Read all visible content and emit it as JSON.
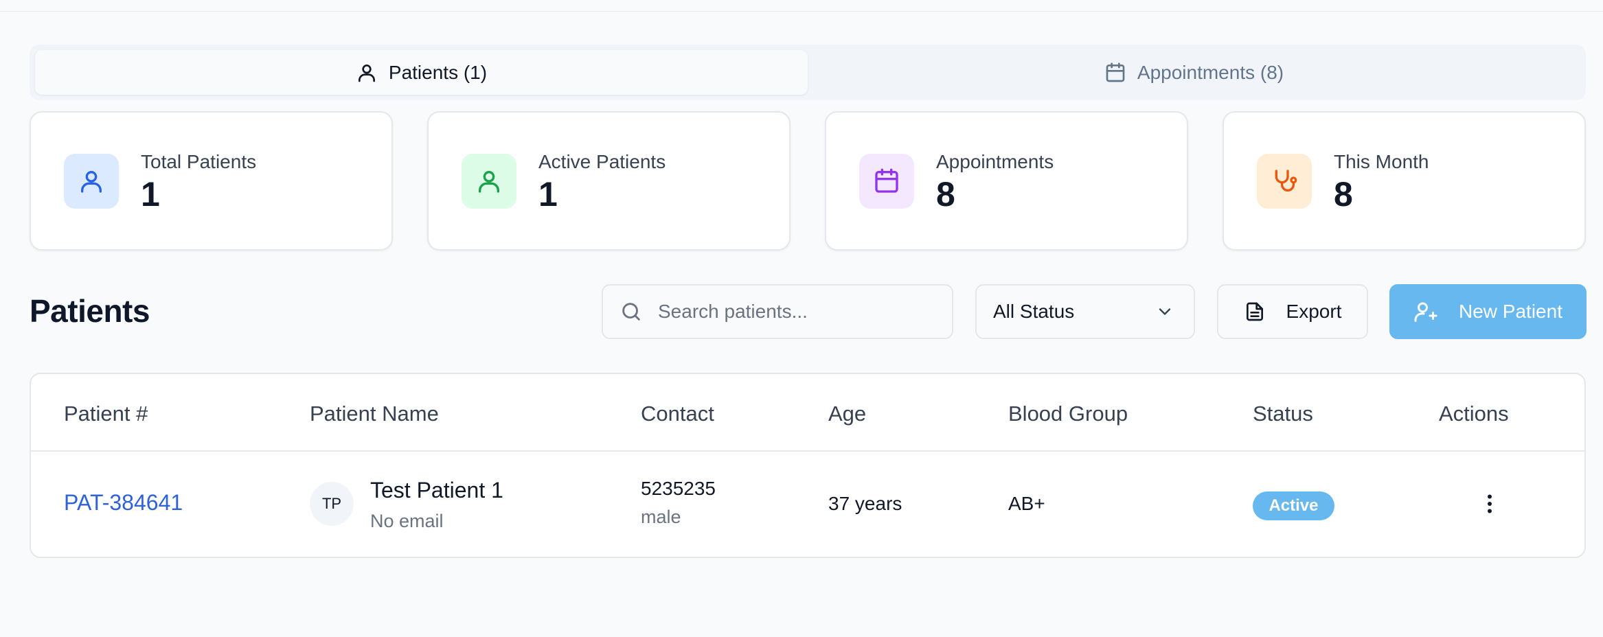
{
  "tabs": [
    {
      "label": "Patients (1)",
      "icon": "user-icon",
      "active": true
    },
    {
      "label": "Appointments (8)",
      "icon": "calendar-icon",
      "active": false
    }
  ],
  "stats": [
    {
      "label": "Total Patients",
      "value": "1",
      "icon": "user-icon",
      "bg": "#dbeafe",
      "color": "#2563eb"
    },
    {
      "label": "Active Patients",
      "value": "1",
      "icon": "user-icon",
      "bg": "#dcfce7",
      "color": "#16a34a"
    },
    {
      "label": "Appointments",
      "value": "8",
      "icon": "calendar-icon",
      "bg": "#f3e8ff",
      "color": "#9333ea"
    },
    {
      "label": "This Month",
      "value": "8",
      "icon": "stethoscope-icon",
      "bg": "#ffedd5",
      "color": "#ea580c"
    }
  ],
  "toolbar": {
    "title": "Patients",
    "search_placeholder": "Search patients...",
    "status_filter": "All Status",
    "export_label": "Export",
    "new_label": "New Patient",
    "accent": "#66b8ee"
  },
  "table": {
    "headers": [
      "Patient #",
      "Patient Name",
      "Contact",
      "Age",
      "Blood Group",
      "Status",
      "Actions"
    ],
    "rows": [
      {
        "id": "PAT-384641",
        "initials": "TP",
        "name": "Test Patient 1",
        "email": "No email",
        "phone": "5235235",
        "gender": "male",
        "age": "37 years",
        "blood": "AB+",
        "status": "Active"
      }
    ]
  }
}
